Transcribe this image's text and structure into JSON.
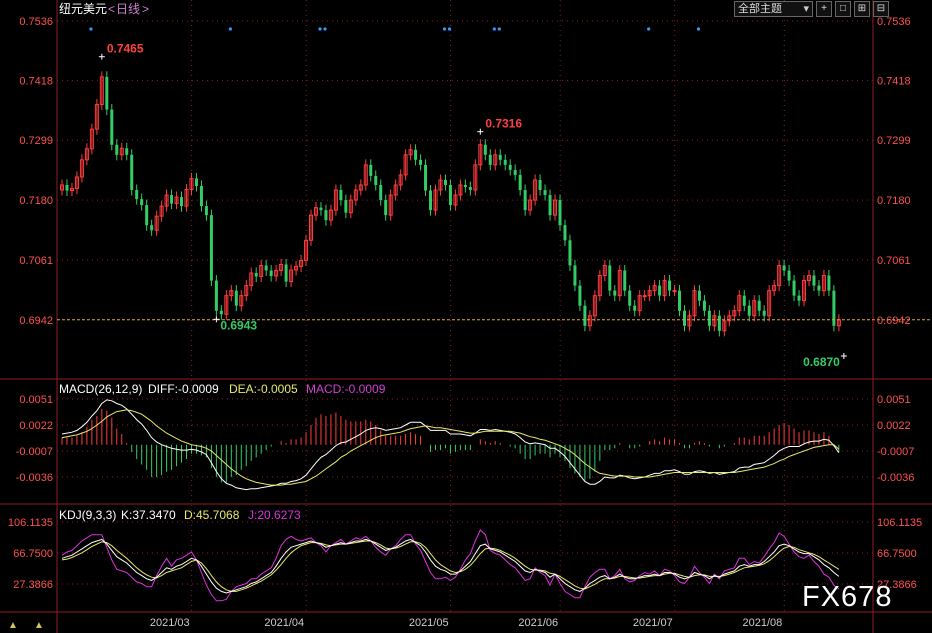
{
  "header": {
    "symbol": "纽元美元",
    "period": "日线",
    "theme_select": "全部主题",
    "tool_icons": [
      "cursor-icon",
      "square-icon",
      "zoom-in-icon",
      "zoom-out-icon"
    ]
  },
  "colors": {
    "up": "#ff3c3c",
    "down": "#33cc66",
    "macd_diff": "#ffffff",
    "macd_dea": "#e8e86a",
    "macd_label": "#d040d0",
    "kdj_j": "#e030e0",
    "price_label": "#ff4040",
    "grid": "#8b1f1f",
    "last_price_line": "#d8a040"
  },
  "price_panel": {
    "y_ticks": [
      "0.7536",
      "0.7418",
      "0.7299",
      "0.7180",
      "0.7061",
      "0.6942"
    ],
    "right_last_label": "0.6942",
    "annotations": [
      {
        "text": "0.7465",
        "value": 0.7465,
        "index": 8,
        "color": "red"
      },
      {
        "text": "0.7316",
        "value": 0.7316,
        "index": 84,
        "color": "red"
      },
      {
        "text": "0.6943",
        "value": 0.6943,
        "index": 31,
        "color": "green"
      },
      {
        "text": "0.6870",
        "value": 0.687,
        "index": 157,
        "color": "green"
      }
    ],
    "dot_marker_indices": [
      3,
      31,
      49,
      50,
      74,
      75,
      84,
      85,
      115,
      125
    ]
  },
  "macd_panel": {
    "label": "MACD(26,12,9)",
    "diff": "DIFF:-0.0009",
    "dea": "DEA:-0.0005",
    "macd": "MACD:-0.0009",
    "y_ticks": [
      "0.0051",
      "0.0022",
      "-0.0007",
      "-0.0036"
    ]
  },
  "kdj_panel": {
    "label": "KDJ(9,3,3)",
    "k": "K:37.3470",
    "d": "D:45.7068",
    "j": "J:20.6273",
    "y_ticks": [
      "106.1135",
      "66.7500",
      "27.3866"
    ]
  },
  "x_labels": [
    "2021/03",
    "2021/04",
    "2021/05",
    "2021/06",
    "2021/07",
    "2021/08"
  ],
  "watermark": "FX678",
  "status_arrows": [
    "▲",
    "▲"
  ],
  "chart_data": [
    {
      "type": "candlestick",
      "title": "纽元美元 <日线>",
      "ylim": [
        0.687,
        0.7536
      ],
      "y_ticks": [
        0.7536,
        0.7418,
        0.7299,
        0.718,
        0.7061,
        0.6942
      ],
      "x_ticks": [
        {
          "label": "2021/03",
          "index": 18
        },
        {
          "label": "2021/04",
          "index": 41
        },
        {
          "label": "2021/05",
          "index": 70
        },
        {
          "label": "2021/06",
          "index": 92
        },
        {
          "label": "2021/07",
          "index": 115
        },
        {
          "label": "2021/08",
          "index": 137
        }
      ],
      "last_price": 0.6942,
      "closes": [
        0.721,
        0.7199,
        0.7203,
        0.7226,
        0.726,
        0.7282,
        0.7321,
        0.737,
        0.7425,
        0.736,
        0.729,
        0.727,
        0.7283,
        0.727,
        0.72,
        0.7182,
        0.717,
        0.713,
        0.712,
        0.7148,
        0.7168,
        0.719,
        0.7173,
        0.7186,
        0.7168,
        0.7201,
        0.7223,
        0.7208,
        0.7168,
        0.715,
        0.702,
        0.696,
        0.6953,
        0.699,
        0.7,
        0.697,
        0.699,
        0.701,
        0.7035,
        0.7028,
        0.705,
        0.704,
        0.7029,
        0.704,
        0.7052,
        0.7018,
        0.7041,
        0.7048,
        0.706,
        0.71,
        0.715,
        0.7165,
        0.716,
        0.714,
        0.716,
        0.72,
        0.718,
        0.7155,
        0.718,
        0.72,
        0.721,
        0.725,
        0.7228,
        0.721,
        0.718,
        0.715,
        0.719,
        0.721,
        0.723,
        0.727,
        0.728,
        0.726,
        0.725,
        0.7199,
        0.716,
        0.72,
        0.722,
        0.721,
        0.717,
        0.719,
        0.721,
        0.7206,
        0.72,
        0.725,
        0.729,
        0.727,
        0.725,
        0.727,
        0.726,
        0.725,
        0.724,
        0.723,
        0.72,
        0.716,
        0.718,
        0.722,
        0.72,
        0.719,
        0.715,
        0.718,
        0.713,
        0.71,
        0.705,
        0.701,
        0.697,
        0.693,
        0.695,
        0.699,
        0.703,
        0.705,
        0.7,
        0.699,
        0.704,
        0.7,
        0.697,
        0.696,
        0.699,
        0.699,
        0.7,
        0.701,
        0.699,
        0.702,
        0.7,
        0.7,
        0.696,
        0.693,
        0.695,
        0.7,
        0.698,
        0.696,
        0.693,
        0.695,
        0.692,
        0.694,
        0.695,
        0.696,
        0.699,
        0.697,
        0.695,
        0.698,
        0.696,
        0.695,
        0.7,
        0.701,
        0.705,
        0.704,
        0.702,
        0.699,
        0.698,
        0.702,
        0.703,
        0.701,
        0.7,
        0.703,
        0.7,
        0.693,
        0.6942
      ],
      "macd": {
        "diff": [
          0.0012,
          0.0013,
          0.0014,
          0.0016,
          0.002,
          0.0025,
          0.0032,
          0.0038,
          0.0046,
          0.005,
          0.0049,
          0.0046,
          0.0044,
          0.004,
          0.0034,
          0.0028,
          0.0023,
          0.0016,
          0.0008,
          0.0003,
          0.0,
          -0.0002,
          -0.0004,
          -0.0005,
          -0.0006,
          -0.0006,
          -0.0005,
          -0.0006,
          -0.0008,
          -0.0011,
          -0.002,
          -0.003,
          -0.0038,
          -0.0043,
          -0.0045,
          -0.0048,
          -0.0049,
          -0.005,
          -0.0049,
          -0.0049,
          -0.0048,
          -0.0047,
          -0.0046,
          -0.0045,
          -0.0043,
          -0.0043,
          -0.0041,
          -0.004,
          -0.0038,
          -0.0034,
          -0.0027,
          -0.002,
          -0.0014,
          -0.0011,
          -0.0006,
          -0.0001,
          0.0002,
          0.0003,
          0.0006,
          0.0009,
          0.0012,
          0.0016,
          0.0018,
          0.0019,
          0.0018,
          0.0016,
          0.0017,
          0.0018,
          0.0019,
          0.0022,
          0.0025,
          0.0025,
          0.0025,
          0.0021,
          0.0016,
          0.0016,
          0.0016,
          0.0016,
          0.0012,
          0.0012,
          0.0012,
          0.0011,
          0.001,
          0.0013,
          0.0017,
          0.0017,
          0.0016,
          0.0017,
          0.0016,
          0.0015,
          0.0014,
          0.0012,
          0.0008,
          0.0003,
          0.0001,
          0.0002,
          0.0001,
          0.0,
          -0.0004,
          -0.0004,
          -0.0008,
          -0.0013,
          -0.002,
          -0.0027,
          -0.0034,
          -0.0041,
          -0.0044,
          -0.0044,
          -0.0041,
          -0.0036,
          -0.0037,
          -0.0037,
          -0.0034,
          -0.0035,
          -0.0037,
          -0.0038,
          -0.0037,
          -0.0036,
          -0.0034,
          -0.0032,
          -0.0032,
          -0.0029,
          -0.0029,
          -0.0028,
          -0.003,
          -0.0033,
          -0.0033,
          -0.003,
          -0.0029,
          -0.003,
          -0.0032,
          -0.0031,
          -0.0033,
          -0.0032,
          -0.0031,
          -0.003,
          -0.0026,
          -0.0025,
          -0.0025,
          -0.0022,
          -0.0021,
          -0.002,
          -0.0016,
          -0.0012,
          -0.0007,
          -0.0004,
          -0.0002,
          -0.0002,
          -0.0002,
          0.0001,
          0.0003,
          0.0004,
          0.0004,
          0.0006,
          0.0005,
          -0.0001,
          -0.0009
        ],
        "dea": [
          0.0008,
          0.0009,
          0.001,
          0.0011,
          0.0013,
          0.0015,
          0.0018,
          0.0022,
          0.0026,
          0.0031,
          0.0034,
          0.0037,
          0.0038,
          0.0039,
          0.0038,
          0.0036,
          0.0034,
          0.003,
          0.0026,
          0.0021,
          0.0017,
          0.0013,
          0.001,
          0.0007,
          0.0004,
          0.0002,
          0.0,
          -0.0001,
          -0.0002,
          -0.0004,
          -0.0007,
          -0.0012,
          -0.0017,
          -0.0022,
          -0.0027,
          -0.0031,
          -0.0035,
          -0.0038,
          -0.004,
          -0.0042,
          -0.0043,
          -0.0044,
          -0.0045,
          -0.0045,
          -0.0045,
          -0.0044,
          -0.0044,
          -0.0043,
          -0.0042,
          -0.0041,
          -0.0038,
          -0.0035,
          -0.0031,
          -0.0027,
          -0.0023,
          -0.0019,
          -0.0014,
          -0.0011,
          -0.0007,
          -0.0004,
          -0.0001,
          0.0002,
          0.0005,
          0.0008,
          0.001,
          0.0011,
          0.0012,
          0.0013,
          0.0014,
          0.0016,
          0.0018,
          0.0019,
          0.002,
          0.0021,
          0.002,
          0.0019,
          0.0019,
          0.0018,
          0.0017,
          0.0016,
          0.0015,
          0.0014,
          0.0013,
          0.0013,
          0.0014,
          0.0015,
          0.0015,
          0.0015,
          0.0015,
          0.0015,
          0.0015,
          0.0014,
          0.0013,
          0.0011,
          0.0009,
          0.0008,
          0.0006,
          0.0005,
          0.0003,
          0.0001,
          -0.0001,
          -0.0004,
          -0.0007,
          -0.0011,
          -0.0016,
          -0.0021,
          -0.0025,
          -0.0029,
          -0.0032,
          -0.0033,
          -0.0034,
          -0.0035,
          -0.0035,
          -0.0035,
          -0.0035,
          -0.0036,
          -0.0036,
          -0.0036,
          -0.0036,
          -0.0035,
          -0.0034,
          -0.0033,
          -0.0032,
          -0.0031,
          -0.0031,
          -0.0031,
          -0.0031,
          -0.0031,
          -0.0031,
          -0.0031,
          -0.0031,
          -0.0031,
          -0.0031,
          -0.0031,
          -0.0031,
          -0.0031,
          -0.003,
          -0.0029,
          -0.0028,
          -0.0027,
          -0.0026,
          -0.0025,
          -0.0023,
          -0.0021,
          -0.0018,
          -0.0016,
          -0.0013,
          -0.0011,
          -0.0009,
          -0.0007,
          -0.0005,
          -0.0003,
          -0.0002,
          -0.0001,
          0.0,
          0.0,
          -0.0005
        ]
      },
      "kdj": {
        "k": [
          60,
          62,
          64,
          68,
          72,
          76,
          80,
          82,
          84,
          78,
          70,
          62,
          58,
          54,
          48,
          42,
          38,
          34,
          32,
          36,
          42,
          48,
          46,
          50,
          52,
          56,
          60,
          58,
          50,
          40,
          30,
          22,
          18,
          16,
          18,
          20,
          22,
          24,
          28,
          30,
          34,
          38,
          42,
          50,
          60,
          68,
          74,
          76,
          78,
          80,
          82,
          80,
          78,
          74,
          76,
          78,
          80,
          78,
          80,
          82,
          82,
          84,
          82,
          78,
          74,
          70,
          72,
          74,
          78,
          82,
          84,
          80,
          76,
          68,
          58,
          50,
          46,
          44,
          40,
          40,
          44,
          50,
          56,
          66,
          76,
          78,
          72,
          70,
          68,
          64,
          60,
          56,
          50,
          44,
          42,
          46,
          44,
          42,
          36,
          40,
          34,
          28,
          24,
          20,
          18,
          22,
          28,
          32,
          36,
          38,
          34,
          36,
          40,
          36,
          34,
          34,
          36,
          38,
          38,
          40,
          38,
          42,
          42,
          40,
          36,
          34,
          36,
          42,
          40,
          38,
          34,
          38,
          36,
          40,
          42,
          44,
          50,
          52,
          50,
          52,
          52,
          56,
          62,
          68,
          76,
          78,
          76,
          72,
          68,
          66,
          66,
          62,
          58,
          52,
          48,
          42,
          37
        ],
        "d": [
          58,
          59,
          61,
          64,
          67,
          71,
          75,
          78,
          81,
          80,
          76,
          70,
          65,
          60,
          54,
          48,
          43,
          39,
          36,
          35,
          38,
          42,
          44,
          46,
          48,
          52,
          56,
          58,
          54,
          47,
          38,
          30,
          24,
          20,
          18,
          18,
          20,
          22,
          25,
          28,
          31,
          35,
          39,
          45,
          52,
          60,
          67,
          72,
          76,
          78,
          80,
          80,
          79,
          77,
          76,
          77,
          78,
          78,
          79,
          80,
          81,
          82,
          82,
          80,
          77,
          73,
          72,
          73,
          75,
          78,
          81,
          81,
          79,
          74,
          66,
          58,
          52,
          48,
          44,
          42,
          43,
          46,
          51,
          58,
          66,
          72,
          73,
          72,
          70,
          67,
          64,
          60,
          55,
          50,
          46,
          45,
          45,
          44,
          41,
          40,
          37,
          33,
          29,
          25,
          22,
          21,
          24,
          27,
          31,
          34,
          34,
          35,
          37,
          37,
          36,
          35,
          35,
          36,
          37,
          38,
          38,
          40,
          41,
          41,
          39,
          37,
          36,
          38,
          39,
          39,
          37,
          37,
          37,
          38,
          40,
          42,
          45,
          48,
          49,
          50,
          51,
          53,
          57,
          62,
          68,
          73,
          75,
          74,
          71,
          69,
          67,
          65,
          62,
          58,
          54,
          50,
          46
        ],
        "j": [
          64,
          68,
          70,
          76,
          82,
          86,
          90,
          90,
          90,
          74,
          58,
          46,
          44,
          42,
          36,
          30,
          28,
          24,
          24,
          38,
          50,
          60,
          50,
          58,
          60,
          64,
          68,
          58,
          42,
          26,
          14,
          6,
          6,
          8,
          18,
          24,
          26,
          28,
          34,
          34,
          40,
          44,
          48,
          60,
          76,
          84,
          88,
          84,
          82,
          84,
          86,
          80,
          76,
          68,
          76,
          80,
          84,
          78,
          82,
          86,
          84,
          88,
          82,
          74,
          68,
          64,
          72,
          76,
          84,
          90,
          90,
          78,
          70,
          56,
          42,
          34,
          34,
          36,
          32,
          36,
          46,
          58,
          66,
          82,
          96,
          90,
          70,
          66,
          64,
          58,
          52,
          48,
          40,
          32,
          34,
          48,
          42,
          38,
          26,
          40,
          28,
          18,
          14,
          10,
          10,
          24,
          36,
          42,
          46,
          46,
          34,
          38,
          46,
          34,
          30,
          32,
          38,
          42,
          40,
          44,
          38,
          46,
          44,
          38,
          30,
          28,
          36,
          50,
          42,
          36,
          28,
          40,
          34,
          44,
          46,
          48,
          60,
          60,
          52,
          56,
          54,
          62,
          72,
          80,
          92,
          88,
          78,
          68,
          62,
          60,
          64,
          56,
          50,
          40,
          36,
          26,
          21
        ]
      }
    }
  ]
}
